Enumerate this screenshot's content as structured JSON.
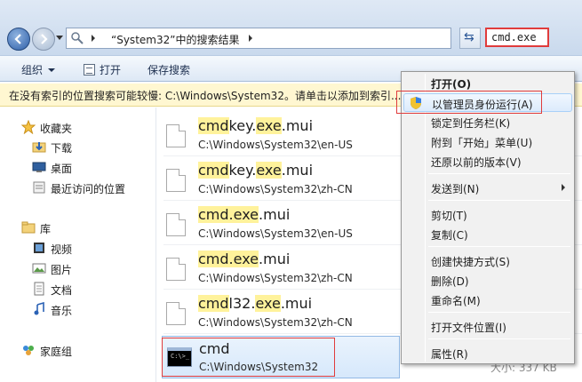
{
  "address": {
    "breadcrumb": "“System32”中的搜索结果",
    "search_value": "cmd.exe"
  },
  "toolbar": {
    "organize": "组织",
    "open": "打开",
    "save_search": "保存搜索"
  },
  "infobar": {
    "text": "在没有索引的位置搜索可能较慢: C:\\Windows\\System32。请单击以添加到索引..."
  },
  "sidebar": {
    "favorites": "收藏夹",
    "downloads": "下载",
    "desktop": "桌面",
    "recent": "最近访问的位置",
    "libraries": "库",
    "videos": "视频",
    "pictures": "图片",
    "documents": "文档",
    "music": "音乐",
    "homegroup": "家庭组"
  },
  "results": [
    {
      "pre": "cmd",
      "mid1": "key.",
      "hl2": "exe",
      "post": ".mui",
      "path": "C:\\Windows\\System32\\en-US"
    },
    {
      "pre": "cmd",
      "mid1": "key.",
      "hl2": "exe",
      "post": ".mui",
      "path": "C:\\Windows\\System32\\zh-CN"
    },
    {
      "pre": "cmd.exe",
      "mid1": "",
      "hl2": "",
      "post": ".mui",
      "path": "C:\\Windows\\System32\\en-US"
    },
    {
      "pre": "cmd.exe",
      "mid1": "",
      "hl2": "",
      "post": ".mui",
      "path": "C:\\Windows\\System32\\zh-CN"
    },
    {
      "pre": "cmd",
      "mid1": "l32.",
      "hl2": "exe",
      "post": ".mui",
      "path": "C:\\Windows\\System32\\zh-CN"
    },
    {
      "pre": "cmd",
      "mid1": "",
      "hl2": "",
      "post": "",
      "path": "C:\\Windows\\System32"
    }
  ],
  "size_text": "大小: 337 KB",
  "menu": {
    "open": "打开(O)",
    "run_as_admin": "以管理员身份运行(A)",
    "pin_taskbar": "锁定到任务栏(K)",
    "pin_start": "附到「开始」菜单(U)",
    "restore": "还原以前的版本(V)",
    "send_to": "发送到(N)",
    "cut": "剪切(T)",
    "copy": "复制(C)",
    "shortcut": "创建快捷方式(S)",
    "delete": "删除(D)",
    "rename": "重命名(M)",
    "open_location": "打开文件位置(I)",
    "properties": "属性(R)"
  },
  "colors": {
    "highlight": "#fff29b",
    "annotation": "#e03c3c"
  }
}
